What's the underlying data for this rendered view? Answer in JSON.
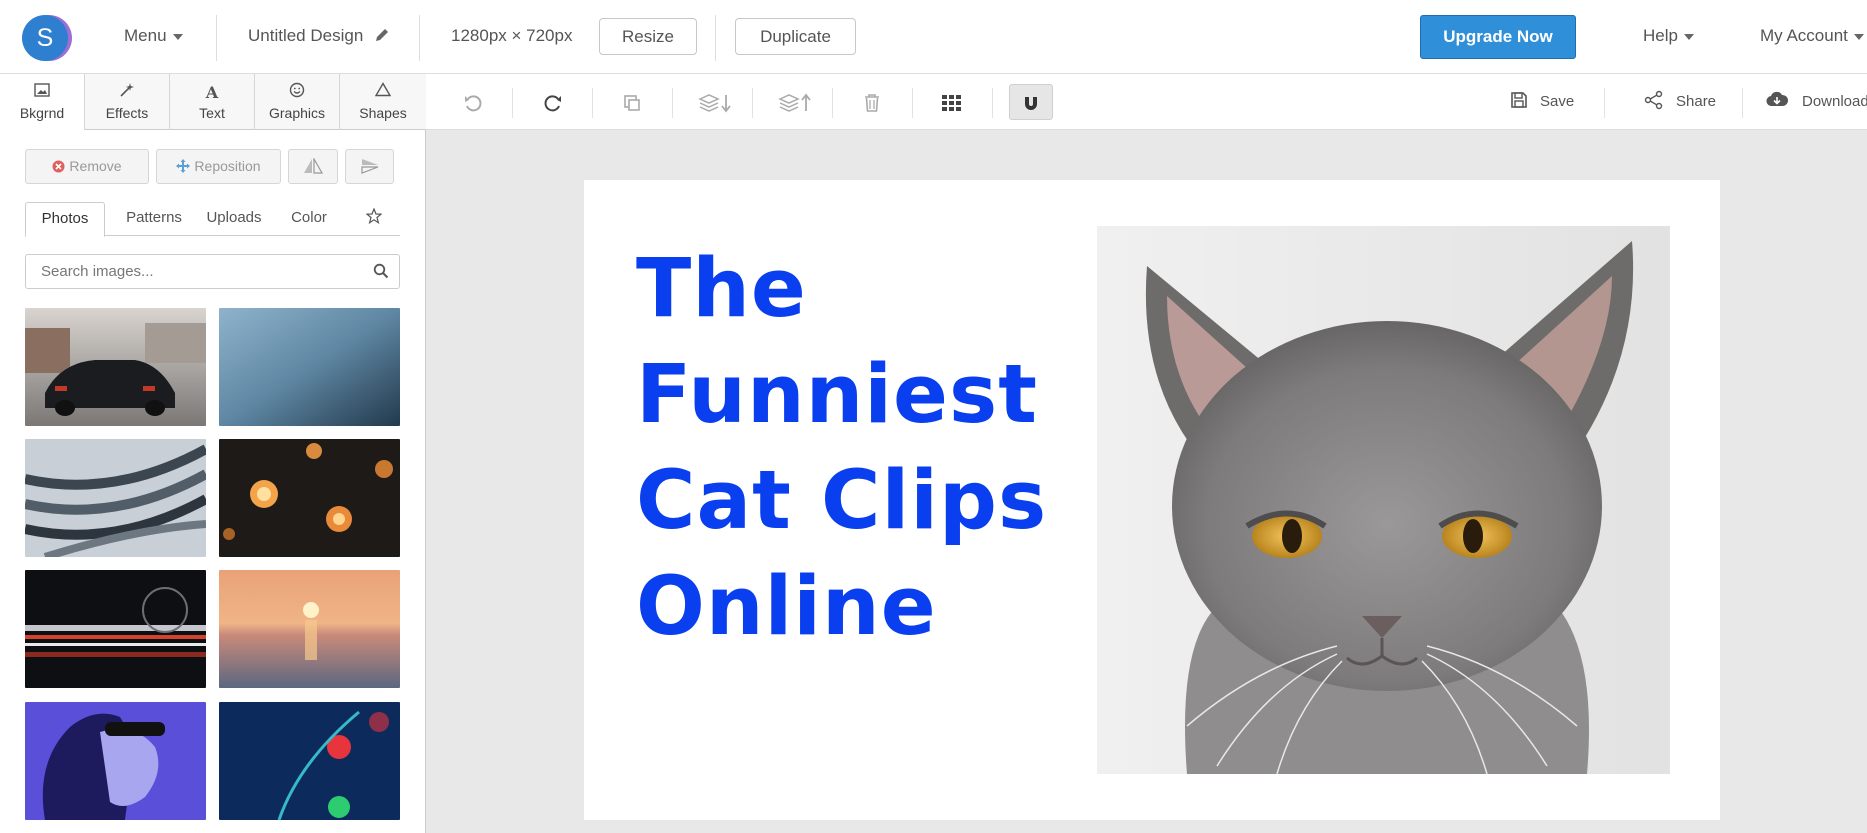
{
  "app": {
    "logo_letter": "S",
    "menu_label": "Menu",
    "design_title": "Untitled Design",
    "dimensions": "1280px × 720px",
    "resize_label": "Resize",
    "duplicate_label": "Duplicate",
    "upgrade_label": "Upgrade Now",
    "help_label": "Help",
    "account_label": "My Account"
  },
  "tool_tabs": [
    {
      "label": "Bkgrnd",
      "icon": "image-icon"
    },
    {
      "label": "Effects",
      "icon": "magic-wand-icon"
    },
    {
      "label": "Text",
      "icon": "text-icon"
    },
    {
      "label": "Graphics",
      "icon": "smiley-icon"
    },
    {
      "label": "Shapes",
      "icon": "triangle-icon"
    }
  ],
  "toolbar": {
    "buttons": [
      "undo-icon",
      "redo-icon",
      "duplicate-icon",
      "send-backward-icon",
      "bring-forward-icon",
      "delete-icon",
      "grid-icon",
      "snap-magnet-icon"
    ],
    "save_label": "Save",
    "share_label": "Share",
    "download_label": "Download"
  },
  "panel": {
    "remove_label": "Remove",
    "reposition_label": "Reposition",
    "subtabs": [
      "Photos",
      "Patterns",
      "Uploads",
      "Color"
    ],
    "search_placeholder": "Search images..."
  },
  "canvas": {
    "headline": [
      "The",
      "Funniest",
      "Cat Clips",
      "Online"
    ],
    "headline_color": "#0a3ff0"
  },
  "colors": {
    "accent": "#2f8fd8",
    "canvas_bg": "#e8e8e8"
  }
}
